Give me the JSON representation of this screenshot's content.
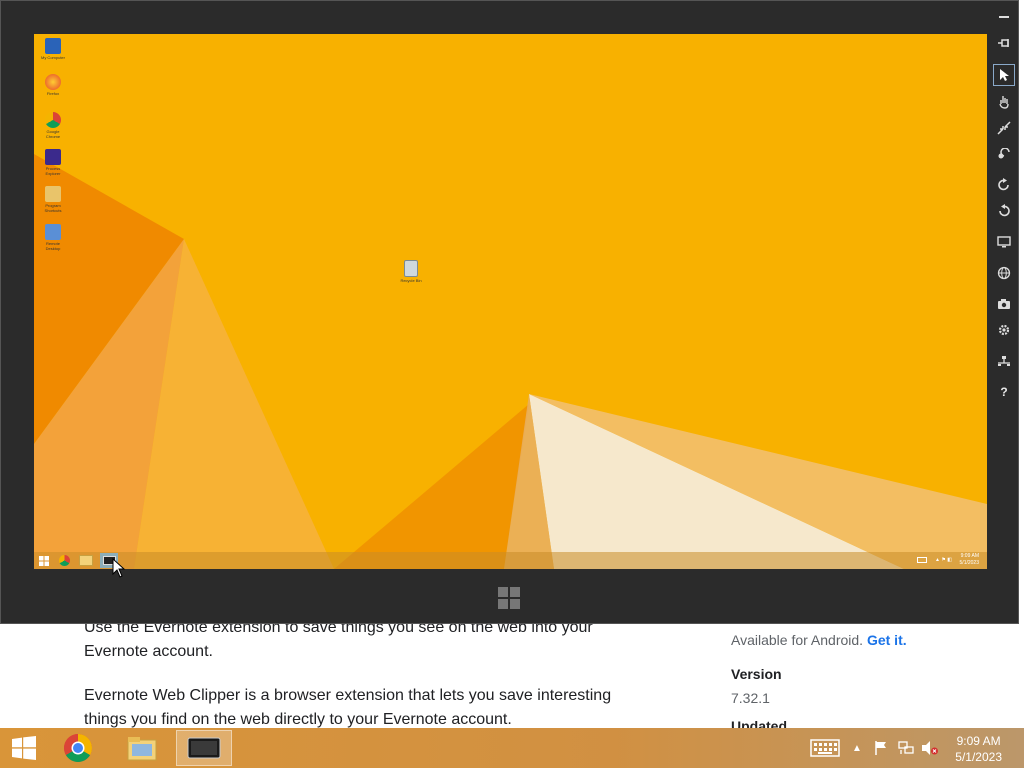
{
  "background_page": {
    "paragraph_1": "Use the Evernote extension to save things you see on the web into your Evernote account.",
    "paragraph_2": "Evernote Web Clipper is a browser extension that lets you save interesting things you find on the web directly to your Evernote account.",
    "side_available": "Available for Android.",
    "side_get_it": "Get it.",
    "version_label": "Version",
    "version_value": "7.32.1",
    "updated_label": "Updated"
  },
  "simulator": {
    "desktop_icons": [
      {
        "label": "My Computer",
        "icon": "computer-icon"
      },
      {
        "label": "Firefox",
        "icon": "firefox-icon"
      },
      {
        "label": "Google Chrome",
        "icon": "chrome-icon"
      },
      {
        "label": "Process Explorer",
        "icon": "app-icon"
      },
      {
        "label": "Program Shortcuts",
        "icon": "folder-icon"
      },
      {
        "label": "Remote Desktop",
        "icon": "network-icon"
      }
    ],
    "recycle_bin_label": "Recycle Bin",
    "clock_time": "9:09 AM",
    "clock_date": "5/1/2023",
    "toolbar": [
      {
        "name": "minimize",
        "icon": "minimize-icon"
      },
      {
        "name": "pin",
        "icon": "pin-icon"
      },
      {
        "name": "mouse-mode",
        "icon": "pointer-icon"
      },
      {
        "name": "touch-mode",
        "icon": "hand-icon"
      },
      {
        "name": "pinch-zoom",
        "icon": "pinch-icon"
      },
      {
        "name": "rotate-touch",
        "icon": "rotate-touch-icon"
      },
      {
        "name": "rotate-clockwise",
        "icon": "rotate-cw-icon"
      },
      {
        "name": "rotate-counterclockwise",
        "icon": "rotate-ccw-icon"
      },
      {
        "name": "change-resolution",
        "icon": "monitor-icon"
      },
      {
        "name": "set-location",
        "icon": "globe-icon"
      },
      {
        "name": "screenshot",
        "icon": "camera-icon"
      },
      {
        "name": "settings",
        "icon": "gear-icon"
      },
      {
        "name": "network",
        "icon": "network-icon"
      },
      {
        "name": "help",
        "icon": "help-icon"
      }
    ]
  },
  "taskbar": {
    "apps": [
      {
        "name": "chrome",
        "icon": "chrome-icon"
      },
      {
        "name": "file-explorer",
        "icon": "folder-icon"
      },
      {
        "name": "simulator",
        "icon": "tablet-icon",
        "active": true
      }
    ],
    "clock_time": "9:09 AM",
    "clock_date": "5/1/2023"
  },
  "colors": {
    "desktop_yellow": "#f9b200",
    "desktop_orange": "#ef8a00",
    "desktop_cream": "#f4e6c8",
    "link_blue": "#1a73e8",
    "simulator_frame": "#2b2b2b"
  }
}
